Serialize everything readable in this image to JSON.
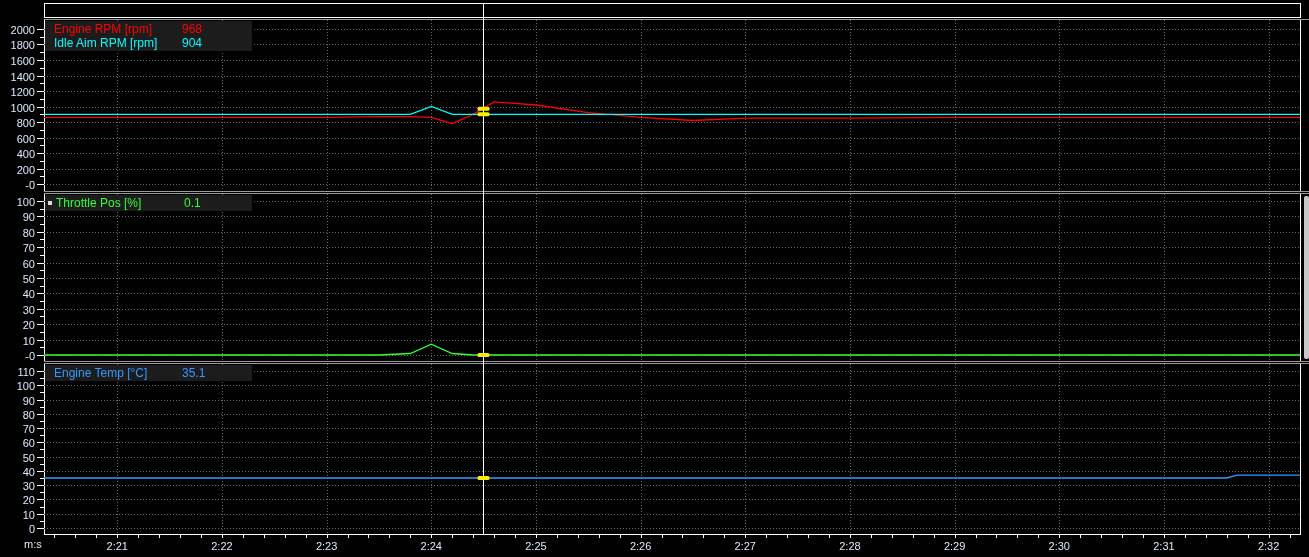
{
  "panels": [
    {
      "readouts": [
        {
          "value": "968",
          "selected": false
        },
        {
          "value": "904",
          "selected": false
        }
      ],
      "chart_data": {
        "type": "line",
        "x": [
          140.3,
          141,
          142,
          143,
          143.5,
          143.8,
          144.0,
          144.2,
          144.4,
          144.6,
          145,
          145.5,
          146,
          146.5,
          147,
          148,
          149,
          150,
          151,
          151.6,
          151.7,
          152,
          152.3
        ],
        "series": [
          {
            "name": "Engine RPM [rpm]",
            "color": "#ff0000",
            "values": [
              860,
              860,
              860,
              860,
              870,
              870,
              860,
              780,
              900,
              1060,
              1020,
              920,
              860,
              820,
              850,
              850,
              860,
              860,
              860,
              860,
              860,
              860,
              860
            ]
          },
          {
            "name": "Idle Aim RPM [rpm]",
            "color": "#00ffff",
            "values": [
              900,
              900,
              900,
              900,
              900,
              900,
              1000,
              900,
              900,
              900,
              900,
              900,
              900,
              900,
              900,
              900,
              900,
              900,
              900,
              900,
              900,
              900,
              900
            ]
          }
        ],
        "xlim": [
          140.3,
          152.3
        ],
        "ylim": [
          -90,
          2116
        ],
        "grid": true,
        "yticks": [
          {
            "value": 0,
            "label": "-0"
          },
          200,
          400,
          600,
          800,
          1000,
          1200,
          1400,
          1600,
          1800,
          2000
        ]
      }
    },
    {
      "readouts": [
        {
          "value": "0.1",
          "selected": true
        }
      ],
      "chart_data": {
        "type": "line",
        "x": [
          140.3,
          141,
          142,
          143,
          143.5,
          143.8,
          144.0,
          144.2,
          144.4,
          144.6,
          145,
          145.5,
          146,
          146.5,
          147,
          148,
          149,
          150,
          151,
          151.6,
          151.7,
          152,
          152.3
        ],
        "series": [
          {
            "name": "Throttle Pos [%]",
            "color": "#33ff33",
            "values": [
              0,
              0,
              0,
              0,
              0,
              1,
              7,
              1,
              0,
              0,
              0,
              0,
              0,
              0,
              0,
              0,
              0,
              0,
              0,
              0,
              0,
              0,
              0
            ]
          }
        ],
        "xlim": [
          140.3,
          152.3
        ],
        "ylim": [
          -3.9,
          104.5
        ],
        "grid": true,
        "yticks": [
          {
            "value": 0,
            "label": "-0"
          },
          10,
          20,
          30,
          40,
          50,
          60,
          70,
          80,
          90,
          100
        ]
      }
    },
    {
      "readouts": [
        {
          "value": "35.1",
          "selected": false
        }
      ],
      "chart_data": {
        "type": "line",
        "x": [
          140.3,
          141,
          142,
          143,
          143.5,
          143.8,
          144.0,
          144.2,
          144.4,
          144.6,
          145,
          145.5,
          146,
          146.5,
          147,
          148,
          149,
          150,
          151,
          151.6,
          151.7,
          152,
          152.3
        ],
        "series": [
          {
            "name": "Engine Temp [°C]",
            "color": "#3399ff",
            "values": [
              35,
              35,
              35,
              35,
              35,
              35,
              35,
              35,
              35,
              35,
              35,
              35,
              35,
              35,
              35,
              35,
              35,
              35,
              35,
              35,
              37,
              37,
              37
            ]
          }
        ],
        "xlim": [
          140.3,
          152.3
        ],
        "ylim": [
          -4.2,
          114.9
        ],
        "xlabel": "m:s",
        "grid": true,
        "xticks": [
          {
            "value": 141,
            "label": "2:21"
          },
          {
            "value": 142,
            "label": "2:22"
          },
          {
            "value": 143,
            "label": "2:23"
          },
          {
            "value": 144,
            "label": "2:24"
          },
          {
            "value": 145,
            "label": "2:25"
          },
          {
            "value": 146,
            "label": "2:26"
          },
          {
            "value": 147,
            "label": "2:27"
          },
          {
            "value": 148,
            "label": "2:28"
          },
          {
            "value": 149,
            "label": "2:29"
          },
          {
            "value": 150,
            "label": "2:30"
          },
          {
            "value": 151,
            "label": "2:31"
          },
          {
            "value": 152,
            "label": "2:32"
          }
        ],
        "yticks": [
          0,
          10,
          20,
          30,
          40,
          50,
          60,
          70,
          80,
          90,
          100,
          110
        ]
      }
    }
  ]
}
